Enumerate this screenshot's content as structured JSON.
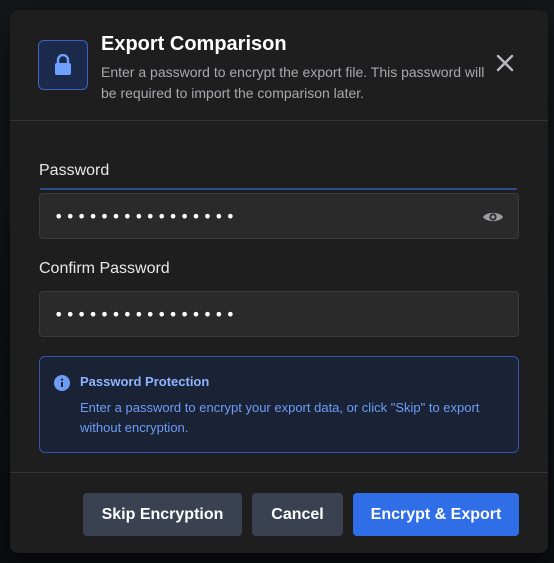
{
  "dialog": {
    "title": "Export Comparison",
    "subtitle": "Enter a password to encrypt the export file. This password will be required to import the comparison later.",
    "icon": "lock-icon",
    "close_icon": "close-icon"
  },
  "fields": {
    "password": {
      "label": "Password",
      "value": "••••••••••••••••",
      "toggle_icon": "eye-icon"
    },
    "confirm_password": {
      "label": "Confirm Password",
      "value": "••••••••••••••••"
    }
  },
  "info": {
    "icon": "info-icon",
    "title": "Password Protection",
    "text": "Enter a password to encrypt your export data, or click \"Skip\" to export without encryption."
  },
  "footer": {
    "skip_label": "Skip Encryption",
    "cancel_label": "Cancel",
    "primary_label": "Encrypt & Export"
  },
  "colors": {
    "accent": "#2f6ee6",
    "info_border": "#2f56b0",
    "info_text": "#6e9cf5",
    "secondary_button": "#3a4252",
    "dialog_bg": "#1e1e1f"
  }
}
